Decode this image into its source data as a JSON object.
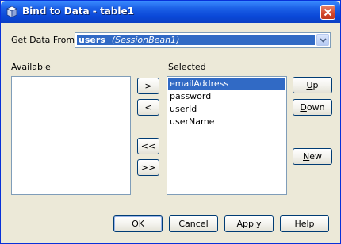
{
  "window": {
    "title": "Bind to Data - table1"
  },
  "source": {
    "label_prefix": "",
    "label_mnemonic": "G",
    "label_rest": "et Data From:",
    "selected_main": "users",
    "selected_sub": "(SessionBean1)"
  },
  "available": {
    "label_mnemonic": "A",
    "label_rest": "vailable",
    "items": []
  },
  "selected": {
    "label_mnemonic": "S",
    "label_rest": "elected",
    "items": [
      "emailAddress",
      "password",
      "userId",
      "userName"
    ],
    "highlighted": "emailAddress"
  },
  "transfer": {
    "add": ">",
    "remove": "<",
    "remove_all": "<<",
    "add_all": ">>"
  },
  "side_buttons": {
    "up_mnemonic": "U",
    "up_rest": "p",
    "down_mnemonic": "D",
    "down_rest": "own",
    "new_mnemonic": "N",
    "new_rest": "ew"
  },
  "footer": {
    "ok": "OK",
    "cancel": "Cancel",
    "apply": "Apply",
    "help": "Help"
  },
  "colors": {
    "titlebar": "#0a48d8",
    "selection": "#316ac5",
    "dialog_bg": "#ece9d8"
  }
}
